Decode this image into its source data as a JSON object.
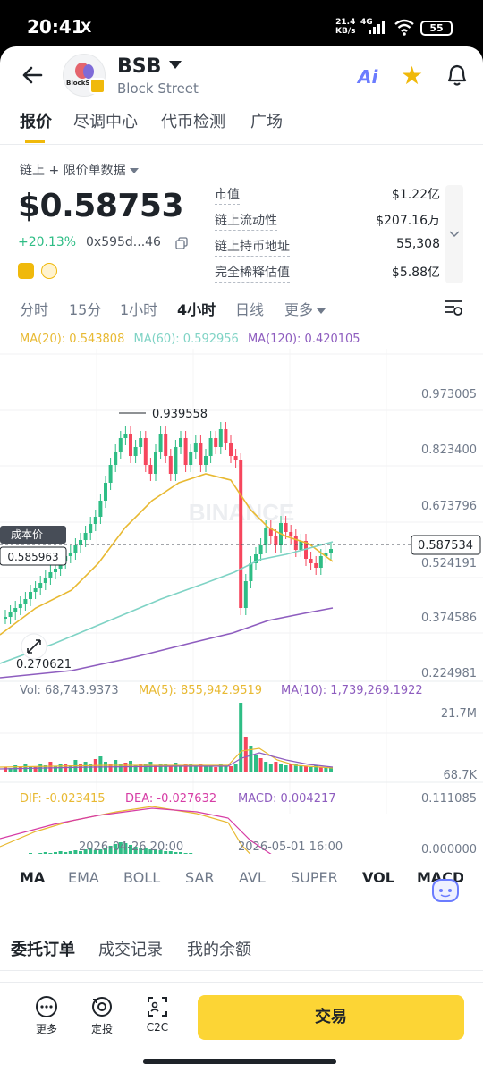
{
  "status": {
    "time": "20:41",
    "x_icon": "X",
    "net_rate": "21.4",
    "net_unit": "KB/s",
    "signal": "4G",
    "battery": "55"
  },
  "header": {
    "symbol": "BSB",
    "name": "Block Street",
    "logo_text": "BlockS"
  },
  "tabs": [
    "报价",
    "尽调中心",
    "代币检测",
    "广场"
  ],
  "data_source": "链上 + 限价单数据",
  "price": "$0.58753",
  "change": "+20.13%",
  "address": "0x595d...46",
  "stats": [
    {
      "label": "市值",
      "value": "$1.22亿"
    },
    {
      "label": "链上流动性",
      "value": "$207.16万"
    },
    {
      "label": "链上持币地址",
      "value": "55,308"
    },
    {
      "label": "完全稀释估值",
      "value": "$5.88亿"
    }
  ],
  "intervals": [
    "分时",
    "15分",
    "1小时",
    "4小时",
    "日线",
    "更多"
  ],
  "ma_legend": {
    "ma20": "MA(20): 0.543808",
    "ma60": "MA(60): 0.592956",
    "ma120": "MA(120): 0.420105"
  },
  "price_axis": [
    "0.973005",
    "0.823400",
    "0.673796",
    "0.524191",
    "0.374586",
    "0.224981"
  ],
  "current_price_tag": "0.587534",
  "cost_label": "成本价",
  "cost_value": "0.585963",
  "high_label": "0.939558",
  "low_label": "0.270621",
  "watermark": "BINANCE",
  "vol_legend": {
    "vol": "Vol: 68,743.9373",
    "ma5": "MA(5): 855,942.9519",
    "ma10": "MA(10): 1,739,269.1922"
  },
  "vol_axis": [
    "21.7M",
    "68.7K"
  ],
  "macd_legend": {
    "dif": "DIF: -0.023415",
    "dea": "DEA: -0.027632",
    "macd": "MACD: 0.004217"
  },
  "macd_axis": [
    "0.111085",
    "0.000000"
  ],
  "time_axis": [
    "2026-04-26 20:00",
    "2026-05-01 16:00"
  ],
  "indicator_tabs": [
    "MA",
    "EMA",
    "BOLL",
    "SAR",
    "AVL",
    "SUPER",
    "VOL",
    "MACD"
  ],
  "order_tabs": [
    "委托订单",
    "成交记录",
    "我的余额"
  ],
  "footer": {
    "more": "更多",
    "dca": "定投",
    "c2c": "C2C",
    "trade": "交易"
  },
  "colors": {
    "up": "#2ebd85",
    "down": "#f6465d",
    "accent": "#f0b90b",
    "ma20": "#e8b932",
    "ma60": "#7fd3c5",
    "ma120": "#8e5dbf"
  },
  "chart_data": {
    "type": "candlestick",
    "interval": "4小时",
    "ylim": [
      0.224981,
      0.973005
    ],
    "high": 0.939558,
    "low": 0.270621,
    "last": 0.587534
  }
}
